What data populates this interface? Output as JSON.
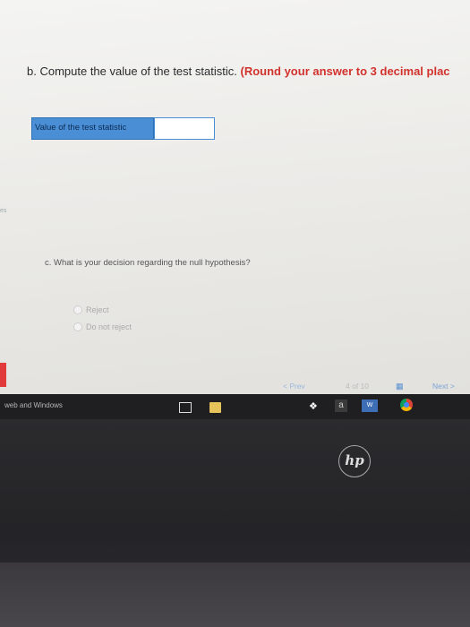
{
  "question_b": {
    "text": "b. Compute the value of the test statistic.",
    "instruction": "(Round your answer to 3 decimal plac"
  },
  "answer": {
    "label": "Value of the test statistic",
    "value": ""
  },
  "side_mark": "es",
  "question_c": {
    "text": "c. What is your decision regarding the null hypothesis?",
    "options": [
      "Reject",
      "Do not reject"
    ]
  },
  "navigation": {
    "prev": "< Prev",
    "page": "4 of 10",
    "next": "Next >"
  },
  "taskbar": {
    "search_text": "web and Windows",
    "amazon_glyph": "a",
    "word_glyph": "W"
  },
  "brand": {
    "logo_text": "hp"
  }
}
